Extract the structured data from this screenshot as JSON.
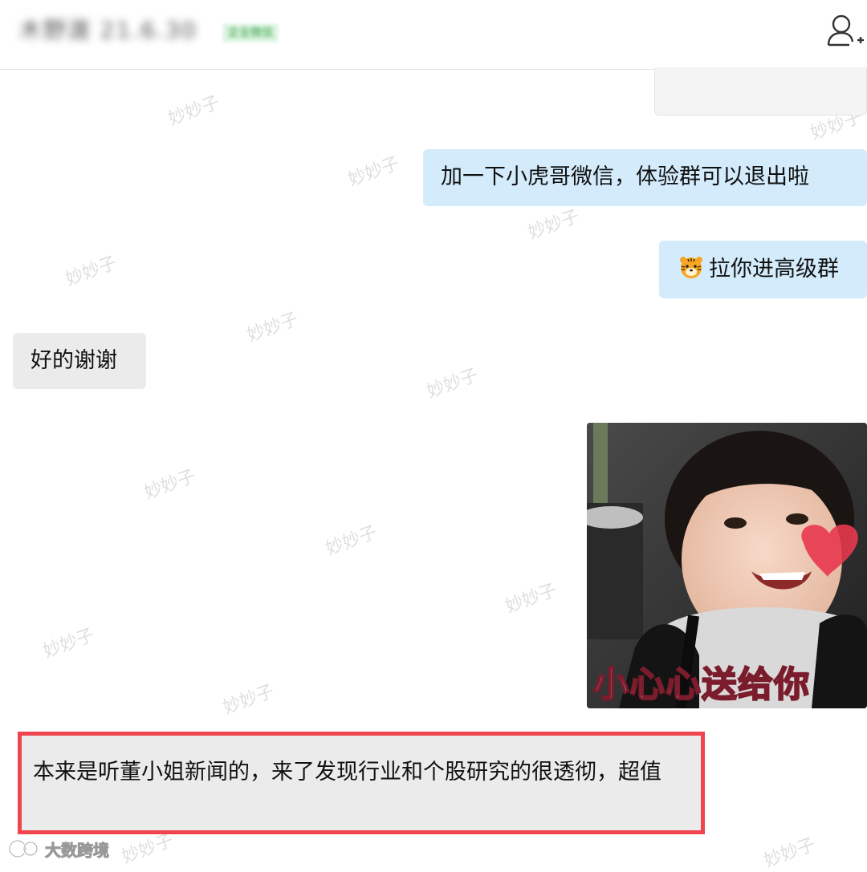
{
  "header": {
    "contact_name": "木野渡 21.6.30",
    "contact_badge": "企业微信",
    "add_contact_icon": "person-plus-icon"
  },
  "watermark": {
    "text": "妙妙子"
  },
  "messages": [
    {
      "direction": "out",
      "text": "加一下小虎哥微信，体验群可以退出啦"
    },
    {
      "direction": "out",
      "emoji": "tiger-emoji",
      "text": "拉你进高级群"
    },
    {
      "direction": "in",
      "text": "好的谢谢"
    },
    {
      "direction": "out",
      "type": "sticker",
      "sticker_text": "小心心送给你"
    },
    {
      "direction": "in",
      "text": "本来是听董小姐新闻的，来了发现行业和个股研究的很透彻，超值",
      "highlighted": true
    }
  ],
  "footer": {
    "brand": "大数跨境"
  },
  "colors": {
    "outgoing_bubble": "#d3ebfb",
    "incoming_bubble": "#ebebeb",
    "highlight_border": "#f0454f"
  }
}
